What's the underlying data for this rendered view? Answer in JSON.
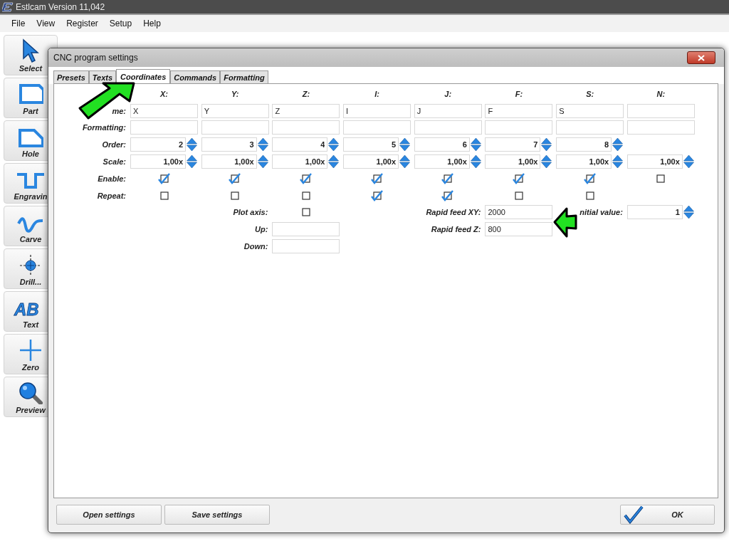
{
  "window": {
    "title": "Estlcam Version 11,042"
  },
  "menu": [
    "File",
    "View",
    "Register",
    "Setup",
    "Help"
  ],
  "tools": [
    {
      "label": "Select"
    },
    {
      "label": "Part"
    },
    {
      "label": "Hole"
    },
    {
      "label": "Engravin"
    },
    {
      "label": "Carve"
    },
    {
      "label": "Drill..."
    },
    {
      "label": "Text",
      "icon_text": "AB"
    },
    {
      "label": "Zero"
    },
    {
      "label": "Preview"
    }
  ],
  "dialog": {
    "title": "CNC program settings",
    "tabs": [
      {
        "label": "Presets",
        "selected": false
      },
      {
        "label": "Texts",
        "selected": false
      },
      {
        "label": "Coordinates",
        "selected": true
      },
      {
        "label": "Commands",
        "selected": false
      },
      {
        "label": "Formatting",
        "selected": false
      }
    ],
    "row_labels": {
      "name": "me:",
      "formatting": "Formatting:",
      "order": "Order:",
      "scale": "Scale:",
      "enable": "Enable:",
      "repeat": "Repeat:"
    },
    "columns": [
      {
        "header": "X:",
        "name": "X",
        "order": "2",
        "scale": "1,00x",
        "enable": true,
        "repeat": false
      },
      {
        "header": "Y:",
        "name": "Y",
        "order": "3",
        "scale": "1,00x",
        "enable": true,
        "repeat": false
      },
      {
        "header": "Z:",
        "name": "Z",
        "order": "4",
        "scale": "1,00x",
        "enable": true,
        "repeat": false
      },
      {
        "header": "I:",
        "name": "I",
        "order": "5",
        "scale": "1,00x",
        "enable": true,
        "repeat": true
      },
      {
        "header": "J:",
        "name": "J",
        "order": "6",
        "scale": "1,00x",
        "enable": true,
        "repeat": true
      },
      {
        "header": "F:",
        "name": "F",
        "order": "7",
        "scale": "1,00x",
        "enable": true,
        "repeat": false
      },
      {
        "header": "S:",
        "name": "S",
        "order": "8",
        "scale": "1,00x",
        "enable": true,
        "repeat": false
      },
      {
        "header": "N:",
        "scale": "1,00x",
        "enable": false
      }
    ],
    "plot_axis": {
      "label": "Plot axis:",
      "checked": false
    },
    "up": {
      "label": "Up:"
    },
    "down": {
      "label": "Down:"
    },
    "rapid_feed_xy": {
      "label": "Rapid feed XY:",
      "value": "2000"
    },
    "rapid_feed_z": {
      "label": "Rapid feed Z:",
      "value": "800"
    },
    "initial_value": {
      "label": "nitial value:",
      "value": "1"
    },
    "buttons": {
      "open": "Open settings",
      "save": "Save settings",
      "ok": "OK"
    }
  }
}
